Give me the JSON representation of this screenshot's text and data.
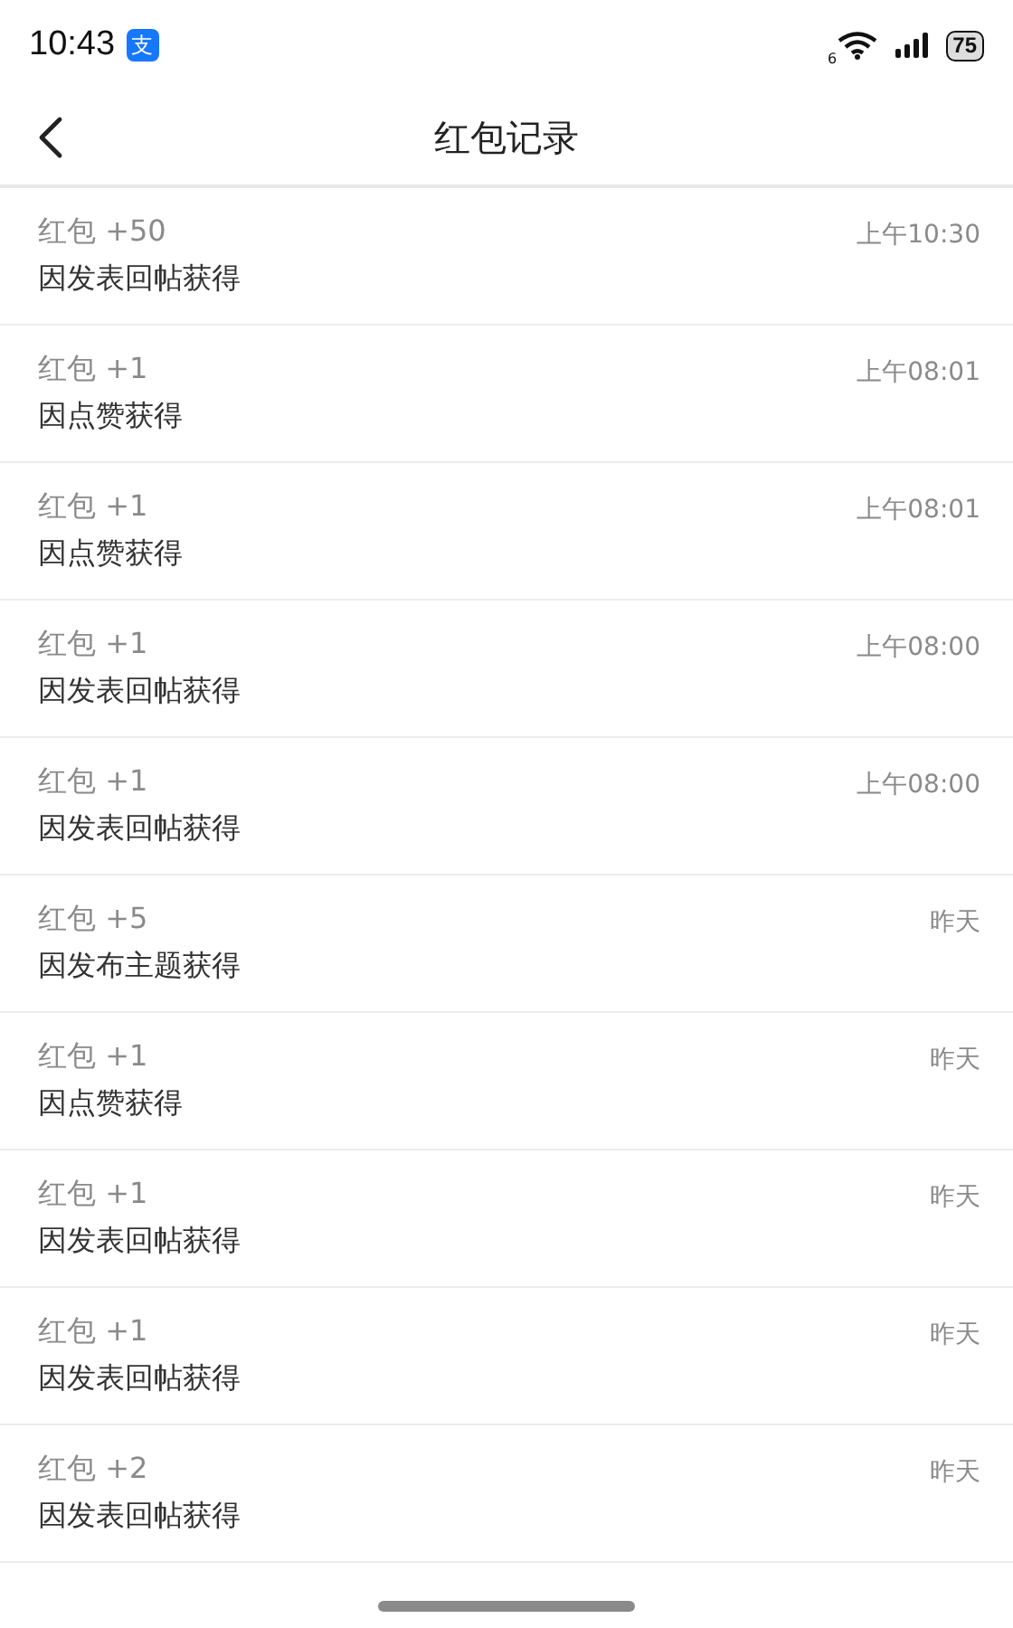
{
  "status_bar": {
    "time": "10:43",
    "app_badge": "支",
    "wifi_label": "6",
    "battery": "75"
  },
  "nav": {
    "title": "红包记录"
  },
  "records": [
    {
      "amount": "红包 +50",
      "reason": "因发表回帖获得",
      "time": "上午10:30"
    },
    {
      "amount": "红包 +1",
      "reason": "因点赞获得",
      "time": "上午08:01"
    },
    {
      "amount": "红包 +1",
      "reason": "因点赞获得",
      "time": "上午08:01"
    },
    {
      "amount": "红包 +1",
      "reason": "因发表回帖获得",
      "time": "上午08:00"
    },
    {
      "amount": "红包 +1",
      "reason": "因发表回帖获得",
      "time": "上午08:00"
    },
    {
      "amount": "红包 +5",
      "reason": "因发布主题获得",
      "time": "昨天"
    },
    {
      "amount": "红包 +1",
      "reason": "因点赞获得",
      "time": "昨天"
    },
    {
      "amount": "红包 +1",
      "reason": "因发表回帖获得",
      "time": "昨天"
    },
    {
      "amount": "红包 +1",
      "reason": "因发表回帖获得",
      "time": "昨天"
    },
    {
      "amount": "红包 +2",
      "reason": "因发表回帖获得",
      "time": "昨天"
    }
  ]
}
